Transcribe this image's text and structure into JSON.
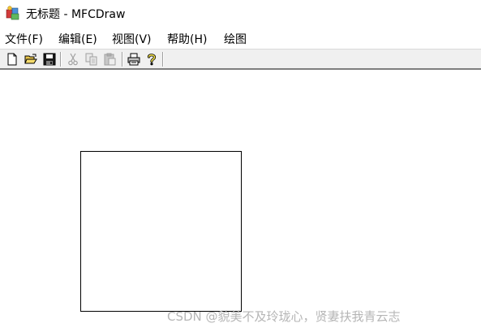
{
  "window": {
    "title": "无标题 - MFCDraw",
    "icon": "mfc-app-icon"
  },
  "menu": {
    "items": [
      {
        "label": "文件(F)"
      },
      {
        "label": "编辑(E)"
      },
      {
        "label": "视图(V)"
      },
      {
        "label": "帮助(H)"
      },
      {
        "label": "绘图"
      }
    ]
  },
  "toolbar": {
    "buttons": [
      {
        "icon": "new-file-icon",
        "enabled": true
      },
      {
        "icon": "open-folder-icon",
        "enabled": true
      },
      {
        "icon": "save-disk-icon",
        "enabled": true
      },
      {
        "icon": "cut-scissors-icon",
        "enabled": false
      },
      {
        "icon": "copy-icon",
        "enabled": false
      },
      {
        "icon": "paste-icon",
        "enabled": false
      },
      {
        "icon": "print-icon",
        "enabled": true
      },
      {
        "icon": "help-question-icon",
        "enabled": true
      }
    ]
  },
  "canvas": {
    "shape": "rectangle"
  },
  "watermark": {
    "text": "CSDN @貌美不及玲珑心，贤妻扶我青云志"
  }
}
